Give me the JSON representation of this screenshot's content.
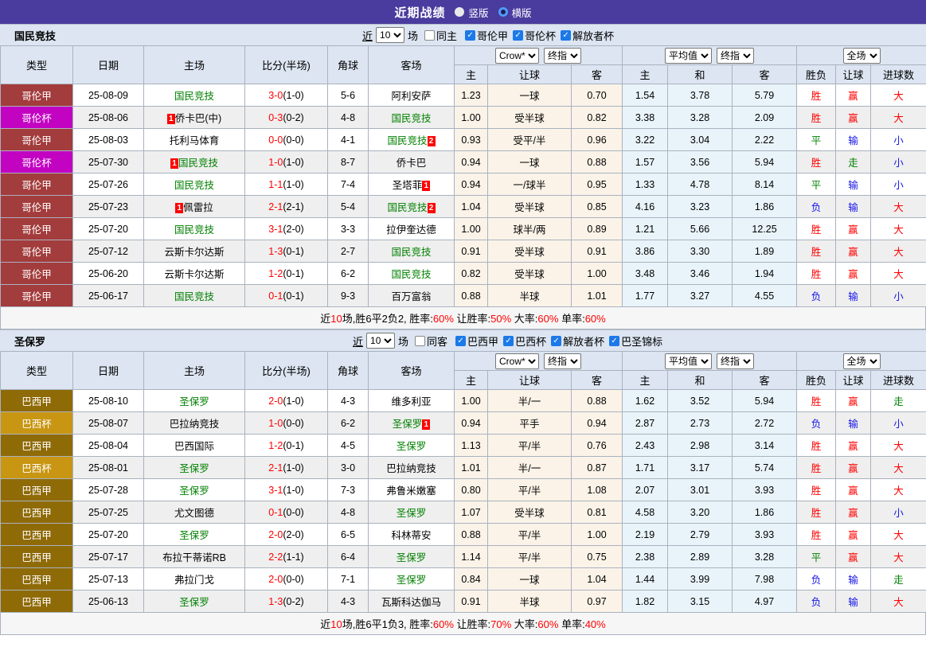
{
  "topbar": {
    "title": "近期战绩",
    "layout_vertical": "竖版",
    "layout_horizontal": "横版"
  },
  "labels": {
    "near": "近",
    "games_count": "10",
    "games": "场"
  },
  "table": {
    "col_headers": [
      "类型",
      "日期",
      "主场",
      "比分(半场)",
      "角球",
      "客场"
    ],
    "sub_headers": [
      "主",
      "让球",
      "客",
      "主",
      "和",
      "客",
      "胜负",
      "让球",
      "进球数"
    ],
    "selects": {
      "odds_company": "Crow*",
      "odds_stage": "终指",
      "avg_source": "平均值",
      "avg_stage": "终指",
      "scope": "全场"
    }
  },
  "league_colors": {
    "哥伦甲": "#a33c3c",
    "哥伦杯": "#c203c2",
    "巴西甲": "#8f6b08",
    "巴西杯": "#c89612"
  },
  "result_colors": {
    "red": "#ff0000",
    "green": "#008000",
    "blue": "#1515e8"
  },
  "colors": {
    "header_bar": "#4a3b9e",
    "panel_bg": "#dce5f1",
    "team_highlight": "#008000",
    "odds_bg": "#fbf3e8",
    "avg_bg": "#e9f4fa"
  },
  "sections": [
    {
      "team": "国民竞技",
      "filter": {
        "same_venue_label": "同主",
        "same_venue_checked": false,
        "leagues": [
          "哥伦甲",
          "哥伦杯",
          "解放者杯"
        ]
      },
      "rows": [
        {
          "league": "哥伦甲",
          "date": "25-08-09",
          "home": "国民竞技",
          "home_green": true,
          "home_card": "",
          "ft": "3-0",
          "ht": "(1-0)",
          "corner": "5-6",
          "away": "阿利安萨",
          "away_green": false,
          "away_card": "",
          "odds": [
            "1.23",
            "一球",
            "0.70"
          ],
          "avg": [
            "1.54",
            "3.78",
            "5.79"
          ],
          "results": [
            [
              "胜",
              "red"
            ],
            [
              "赢",
              "red"
            ],
            [
              "大",
              "red"
            ]
          ]
        },
        {
          "league": "哥伦杯",
          "date": "25-08-06",
          "home": "侨卡巴(中)",
          "home_green": false,
          "home_card": "1",
          "ft": "0-3",
          "ht": "(0-2)",
          "corner": "4-8",
          "away": "国民竞技",
          "away_green": true,
          "away_card": "",
          "odds": [
            "1.00",
            "受半球",
            "0.82"
          ],
          "avg": [
            "3.38",
            "3.28",
            "2.09"
          ],
          "results": [
            [
              "胜",
              "red"
            ],
            [
              "赢",
              "red"
            ],
            [
              "大",
              "red"
            ]
          ]
        },
        {
          "league": "哥伦甲",
          "date": "25-08-03",
          "home": "托利马体育",
          "home_green": false,
          "home_card": "",
          "ft": "0-0",
          "ht": "(0-0)",
          "corner": "4-1",
          "away": "国民竞技",
          "away_green": true,
          "away_card": "2",
          "odds": [
            "0.93",
            "受平/半",
            "0.96"
          ],
          "avg": [
            "3.22",
            "3.04",
            "2.22"
          ],
          "results": [
            [
              "平",
              "green"
            ],
            [
              "输",
              "blue"
            ],
            [
              "小",
              "blue"
            ]
          ]
        },
        {
          "league": "哥伦杯",
          "date": "25-07-30",
          "home": "国民竞技",
          "home_green": true,
          "home_card": "1",
          "ft": "1-0",
          "ht": "(1-0)",
          "corner": "8-7",
          "away": "侨卡巴",
          "away_green": false,
          "away_card": "",
          "odds": [
            "0.94",
            "一球",
            "0.88"
          ],
          "avg": [
            "1.57",
            "3.56",
            "5.94"
          ],
          "results": [
            [
              "胜",
              "red"
            ],
            [
              "走",
              "green"
            ],
            [
              "小",
              "blue"
            ]
          ]
        },
        {
          "league": "哥伦甲",
          "date": "25-07-26",
          "home": "国民竞技",
          "home_green": true,
          "home_card": "",
          "ft": "1-1",
          "ht": "(1-0)",
          "corner": "7-4",
          "away": "圣塔菲",
          "away_green": false,
          "away_card": "1",
          "odds": [
            "0.94",
            "一/球半",
            "0.95"
          ],
          "avg": [
            "1.33",
            "4.78",
            "8.14"
          ],
          "results": [
            [
              "平",
              "green"
            ],
            [
              "输",
              "blue"
            ],
            [
              "小",
              "blue"
            ]
          ]
        },
        {
          "league": "哥伦甲",
          "date": "25-07-23",
          "home": "佩雷拉",
          "home_green": false,
          "home_card": "1",
          "ft": "2-1",
          "ht": "(2-1)",
          "corner": "5-4",
          "away": "国民竞技",
          "away_green": true,
          "away_card": "2",
          "odds": [
            "1.04",
            "受半球",
            "0.85"
          ],
          "avg": [
            "4.16",
            "3.23",
            "1.86"
          ],
          "results": [
            [
              "负",
              "blue"
            ],
            [
              "输",
              "blue"
            ],
            [
              "大",
              "red"
            ]
          ]
        },
        {
          "league": "哥伦甲",
          "date": "25-07-20",
          "home": "国民竞技",
          "home_green": true,
          "home_card": "",
          "ft": "3-1",
          "ht": "(2-0)",
          "corner": "3-3",
          "away": "拉伊奎达德",
          "away_green": false,
          "away_card": "",
          "odds": [
            "1.00",
            "球半/两",
            "0.89"
          ],
          "avg": [
            "1.21",
            "5.66",
            "12.25"
          ],
          "results": [
            [
              "胜",
              "red"
            ],
            [
              "赢",
              "red"
            ],
            [
              "大",
              "red"
            ]
          ]
        },
        {
          "league": "哥伦甲",
          "date": "25-07-12",
          "home": "云斯卡尔达斯",
          "home_green": false,
          "home_card": "",
          "ft": "1-3",
          "ht": "(0-1)",
          "corner": "2-7",
          "away": "国民竞技",
          "away_green": true,
          "away_card": "",
          "odds": [
            "0.91",
            "受半球",
            "0.91"
          ],
          "avg": [
            "3.86",
            "3.30",
            "1.89"
          ],
          "results": [
            [
              "胜",
              "red"
            ],
            [
              "赢",
              "red"
            ],
            [
              "大",
              "red"
            ]
          ]
        },
        {
          "league": "哥伦甲",
          "date": "25-06-20",
          "home": "云斯卡尔达斯",
          "home_green": false,
          "home_card": "",
          "ft": "1-2",
          "ht": "(0-1)",
          "corner": "6-2",
          "away": "国民竞技",
          "away_green": true,
          "away_card": "",
          "odds": [
            "0.82",
            "受半球",
            "1.00"
          ],
          "avg": [
            "3.48",
            "3.46",
            "1.94"
          ],
          "results": [
            [
              "胜",
              "red"
            ],
            [
              "赢",
              "red"
            ],
            [
              "大",
              "red"
            ]
          ]
        },
        {
          "league": "哥伦甲",
          "date": "25-06-17",
          "home": "国民竞技",
          "home_green": true,
          "home_card": "",
          "ft": "0-1",
          "ht": "(0-1)",
          "corner": "9-3",
          "away": "百万富翁",
          "away_green": false,
          "away_card": "",
          "odds": [
            "0.88",
            "半球",
            "1.01"
          ],
          "avg": [
            "1.77",
            "3.27",
            "4.55"
          ],
          "results": [
            [
              "负",
              "blue"
            ],
            [
              "输",
              "blue"
            ],
            [
              "小",
              "blue"
            ]
          ]
        }
      ],
      "summary": [
        {
          "text": "近",
          "red": false
        },
        {
          "text": "10",
          "red": true
        },
        {
          "text": "场,胜6平2负2, 胜率:",
          "red": false
        },
        {
          "text": "60%",
          "red": true
        },
        {
          "text": " 让胜率:",
          "red": false
        },
        {
          "text": "50%",
          "red": true
        },
        {
          "text": " 大率:",
          "red": false
        },
        {
          "text": "60%",
          "red": true
        },
        {
          "text": " 单率:",
          "red": false
        },
        {
          "text": "60%",
          "red": true
        }
      ]
    },
    {
      "team": "圣保罗",
      "filter": {
        "same_venue_label": "同客",
        "same_venue_checked": false,
        "leagues": [
          "巴西甲",
          "巴西杯",
          "解放者杯",
          "巴圣锦标"
        ]
      },
      "rows": [
        {
          "league": "巴西甲",
          "date": "25-08-10",
          "home": "圣保罗",
          "home_green": true,
          "home_card": "",
          "ft": "2-0",
          "ht": "(1-0)",
          "corner": "4-3",
          "away": "维多利亚",
          "away_green": false,
          "away_card": "",
          "odds": [
            "1.00",
            "半/一",
            "0.88"
          ],
          "avg": [
            "1.62",
            "3.52",
            "5.94"
          ],
          "results": [
            [
              "胜",
              "red"
            ],
            [
              "赢",
              "red"
            ],
            [
              "走",
              "green"
            ]
          ]
        },
        {
          "league": "巴西杯",
          "date": "25-08-07",
          "home": "巴拉纳竞技",
          "home_green": false,
          "home_card": "",
          "ft": "1-0",
          "ht": "(0-0)",
          "corner": "6-2",
          "away": "圣保罗",
          "away_green": true,
          "away_card": "1",
          "odds": [
            "0.94",
            "平手",
            "0.94"
          ],
          "avg": [
            "2.87",
            "2.73",
            "2.72"
          ],
          "results": [
            [
              "负",
              "blue"
            ],
            [
              "输",
              "blue"
            ],
            [
              "小",
              "blue"
            ]
          ]
        },
        {
          "league": "巴西甲",
          "date": "25-08-04",
          "home": "巴西国际",
          "home_green": false,
          "home_card": "",
          "ft": "1-2",
          "ht": "(0-1)",
          "corner": "4-5",
          "away": "圣保罗",
          "away_green": true,
          "away_card": "",
          "odds": [
            "1.13",
            "平/半",
            "0.76"
          ],
          "avg": [
            "2.43",
            "2.98",
            "3.14"
          ],
          "results": [
            [
              "胜",
              "red"
            ],
            [
              "赢",
              "red"
            ],
            [
              "大",
              "red"
            ]
          ]
        },
        {
          "league": "巴西杯",
          "date": "25-08-01",
          "home": "圣保罗",
          "home_green": true,
          "home_card": "",
          "ft": "2-1",
          "ht": "(1-0)",
          "corner": "3-0",
          "away": "巴拉纳竞技",
          "away_green": false,
          "away_card": "",
          "odds": [
            "1.01",
            "半/一",
            "0.87"
          ],
          "avg": [
            "1.71",
            "3.17",
            "5.74"
          ],
          "results": [
            [
              "胜",
              "red"
            ],
            [
              "赢",
              "red"
            ],
            [
              "大",
              "red"
            ]
          ]
        },
        {
          "league": "巴西甲",
          "date": "25-07-28",
          "home": "圣保罗",
          "home_green": true,
          "home_card": "",
          "ft": "3-1",
          "ht": "(1-0)",
          "corner": "7-3",
          "away": "弗鲁米嫩塞",
          "away_green": false,
          "away_card": "",
          "odds": [
            "0.80",
            "平/半",
            "1.08"
          ],
          "avg": [
            "2.07",
            "3.01",
            "3.93"
          ],
          "results": [
            [
              "胜",
              "red"
            ],
            [
              "赢",
              "red"
            ],
            [
              "大",
              "red"
            ]
          ]
        },
        {
          "league": "巴西甲",
          "date": "25-07-25",
          "home": "尤文图德",
          "home_green": false,
          "home_card": "",
          "ft": "0-1",
          "ht": "(0-0)",
          "corner": "4-8",
          "away": "圣保罗",
          "away_green": true,
          "away_card": "",
          "odds": [
            "1.07",
            "受半球",
            "0.81"
          ],
          "avg": [
            "4.58",
            "3.20",
            "1.86"
          ],
          "results": [
            [
              "胜",
              "red"
            ],
            [
              "赢",
              "red"
            ],
            [
              "小",
              "blue"
            ]
          ]
        },
        {
          "league": "巴西甲",
          "date": "25-07-20",
          "home": "圣保罗",
          "home_green": true,
          "home_card": "",
          "ft": "2-0",
          "ht": "(2-0)",
          "corner": "6-5",
          "away": "科林蒂安",
          "away_green": false,
          "away_card": "",
          "odds": [
            "0.88",
            "平/半",
            "1.00"
          ],
          "avg": [
            "2.19",
            "2.79",
            "3.93"
          ],
          "results": [
            [
              "胜",
              "red"
            ],
            [
              "赢",
              "red"
            ],
            [
              "大",
              "red"
            ]
          ]
        },
        {
          "league": "巴西甲",
          "date": "25-07-17",
          "home": "布拉干蒂诺RB",
          "home_green": false,
          "home_card": "",
          "ft": "2-2",
          "ht": "(1-1)",
          "corner": "6-4",
          "away": "圣保罗",
          "away_green": true,
          "away_card": "",
          "odds": [
            "1.14",
            "平/半",
            "0.75"
          ],
          "avg": [
            "2.38",
            "2.89",
            "3.28"
          ],
          "results": [
            [
              "平",
              "green"
            ],
            [
              "赢",
              "red"
            ],
            [
              "大",
              "red"
            ]
          ]
        },
        {
          "league": "巴西甲",
          "date": "25-07-13",
          "home": "弗拉门戈",
          "home_green": false,
          "home_card": "",
          "ft": "2-0",
          "ht": "(0-0)",
          "corner": "7-1",
          "away": "圣保罗",
          "away_green": true,
          "away_card": "",
          "odds": [
            "0.84",
            "一球",
            "1.04"
          ],
          "avg": [
            "1.44",
            "3.99",
            "7.98"
          ],
          "results": [
            [
              "负",
              "blue"
            ],
            [
              "输",
              "blue"
            ],
            [
              "走",
              "green"
            ]
          ]
        },
        {
          "league": "巴西甲",
          "date": "25-06-13",
          "home": "圣保罗",
          "home_green": true,
          "home_card": "",
          "ft": "1-3",
          "ht": "(0-2)",
          "corner": "4-3",
          "away": "瓦斯科达伽马",
          "away_green": false,
          "away_card": "",
          "odds": [
            "0.91",
            "半球",
            "0.97"
          ],
          "avg": [
            "1.82",
            "3.15",
            "4.97"
          ],
          "results": [
            [
              "负",
              "blue"
            ],
            [
              "输",
              "blue"
            ],
            [
              "大",
              "red"
            ]
          ]
        }
      ],
      "summary": [
        {
          "text": "近",
          "red": false
        },
        {
          "text": "10",
          "red": true
        },
        {
          "text": "场,胜6平1负3, 胜率:",
          "red": false
        },
        {
          "text": "60%",
          "red": true
        },
        {
          "text": " 让胜率:",
          "red": false
        },
        {
          "text": "70%",
          "red": true
        },
        {
          "text": " 大率:",
          "red": false
        },
        {
          "text": "60%",
          "red": true
        },
        {
          "text": " 单率:",
          "red": false
        },
        {
          "text": "40%",
          "red": true
        }
      ]
    }
  ]
}
